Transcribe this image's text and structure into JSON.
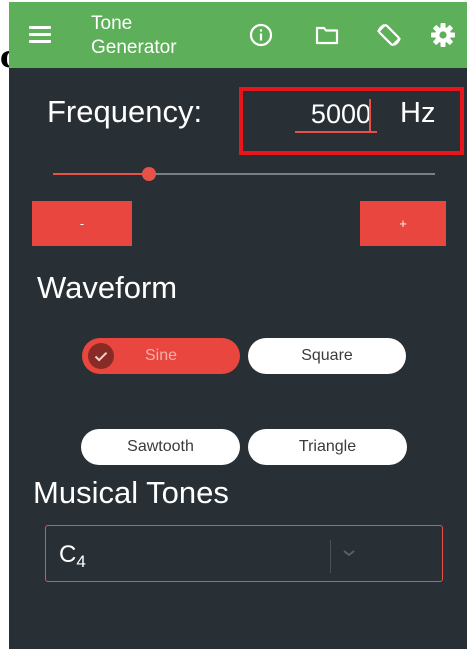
{
  "app": {
    "title_line1": "Tone",
    "title_line2": "Generator",
    "bar_color": "#5eaf5a"
  },
  "toolbar": {
    "icons": [
      "menu-icon",
      "info-icon",
      "folder-icon",
      "screen-rotation-icon",
      "settings-icon"
    ]
  },
  "frequency": {
    "label": "Frequency:",
    "value": "5000",
    "unit": "Hz",
    "slider_level": 0.25
  },
  "stepper": {
    "minus_label": "-",
    "plus_label": "+"
  },
  "waveform": {
    "heading": "Waveform",
    "options": [
      {
        "label": "Sine",
        "selected": true
      },
      {
        "label": "Square",
        "selected": false
      },
      {
        "label": "Sawtooth",
        "selected": false
      },
      {
        "label": "Triangle",
        "selected": false
      }
    ]
  },
  "musical_tones": {
    "heading": "Musical Tones",
    "note": "C",
    "octave": "4"
  },
  "stray_text": "c",
  "colors": {
    "accent": "#e8463e",
    "highlight_box": "#e8161c",
    "background": "#283036"
  }
}
